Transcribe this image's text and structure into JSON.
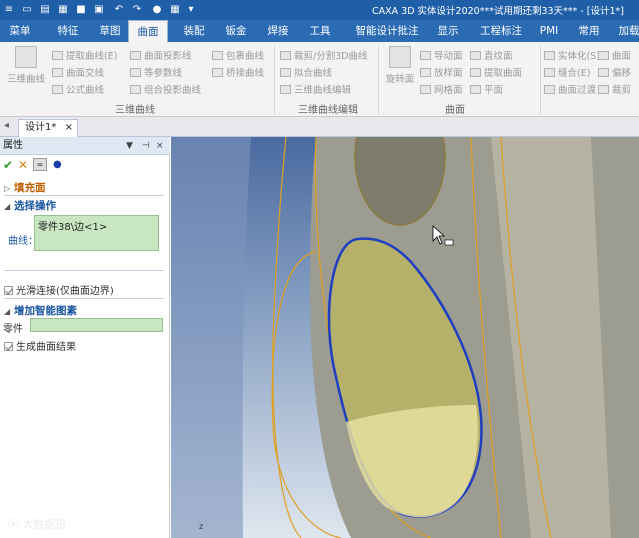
{
  "window": {
    "title": "CAXA 3D 实体设计2020***试用期还剩33天*** - [设计1*]"
  },
  "ribbon_tabs": [
    "菜单",
    "特征",
    "草图",
    "曲面",
    "装配",
    "钣金",
    "焊接",
    "工具",
    "智能设计批注",
    "显示",
    "工程标注",
    "PMI",
    "常用",
    "加载"
  ],
  "active_tab": "曲面",
  "ribbon": {
    "big_button_3d_curve": "三维曲线",
    "curve_items": [
      "提取曲线(E)",
      "曲面交线",
      "公式曲线",
      "曲面投影线",
      "等参数线",
      "组合投影曲线",
      "包裹曲线",
      "桥接曲线"
    ],
    "curve_group": "三维曲线",
    "edit_items": [
      "裁剪/分割3D曲线",
      "拟合曲线",
      "三维曲线编辑"
    ],
    "edit_group": "三维曲线编辑",
    "big_button_revolve": "旋转面",
    "surface_items": [
      "导动面",
      "放样面",
      "网格面",
      "直纹面",
      "提取曲面",
      "平面"
    ],
    "surface_group": "曲面",
    "extra_items": [
      "实体化(S)",
      "缝合(E)",
      "曲面过渡",
      "曲面",
      "偏移",
      "裁剪"
    ]
  },
  "document_tab": "设计1*",
  "properties": {
    "title": "属性",
    "panel_controls": [
      "▼",
      "⊣",
      "×"
    ],
    "section_fill": "填充面",
    "section_select": "选择操作",
    "curve_label": "曲线：",
    "curve_value": "零件38\\边<1>",
    "smooth_option": "光滑连接(仅曲面边界)",
    "section_smart": "增加智能图素",
    "part_label": "零件",
    "generate_option": "生成曲面结果"
  },
  "watermark": "大数据班"
}
